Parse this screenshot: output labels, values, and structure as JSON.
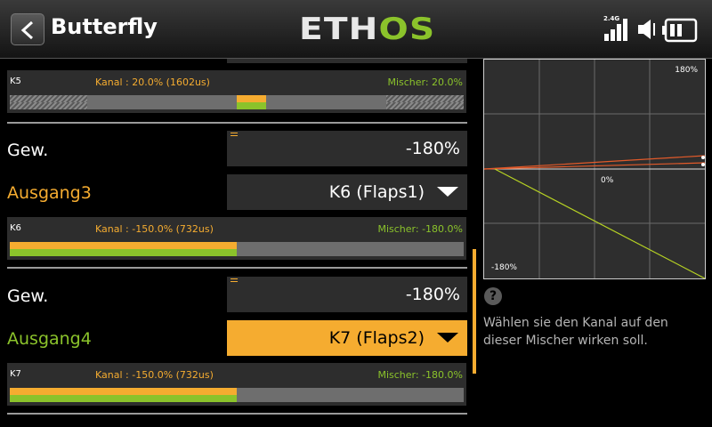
{
  "header": {
    "title": "Butterfly",
    "logo_main": "ETH",
    "logo_accent": "OS",
    "signal_label": "2.4G"
  },
  "k5": {
    "name": "K5",
    "kanal": "Kanal : 20.0% (1602us)",
    "mischer": "Mischer: 20.0%",
    "kanal_fraction": 0.2,
    "mischer_fraction": 0.2
  },
  "group3": {
    "weight_label": "Gew.",
    "weight_value": "-180%",
    "output_label": "Ausgang3",
    "output_value": "K6 (Flaps1)",
    "channel": {
      "name": "K6",
      "kanal": "Kanal : -150.0% (732us)",
      "mischer": "Mischer: -180.0%",
      "kanal_fraction": -1.0,
      "mischer_fraction": -1.0
    }
  },
  "group4": {
    "weight_label": "Gew.",
    "weight_value": "-180%",
    "output_label": "Ausgang4",
    "output_value": "K7 (Flaps2)",
    "channel": {
      "name": "K7",
      "kanal": "Kanal : -150.0% (732us)",
      "mischer": "Mischer: -180.0%",
      "kanal_fraction": -1.0,
      "mischer_fraction": -1.0
    }
  },
  "graph": {
    "top_label": "180%",
    "center_label": "0%",
    "bottom_label": "-180%"
  },
  "help": {
    "icon": "?",
    "text": "Wählen sie den Kanal auf den dieser Mischer wirken soll."
  },
  "colors": {
    "accent_orange": "#f5ac30",
    "accent_green": "#8bc32b"
  }
}
